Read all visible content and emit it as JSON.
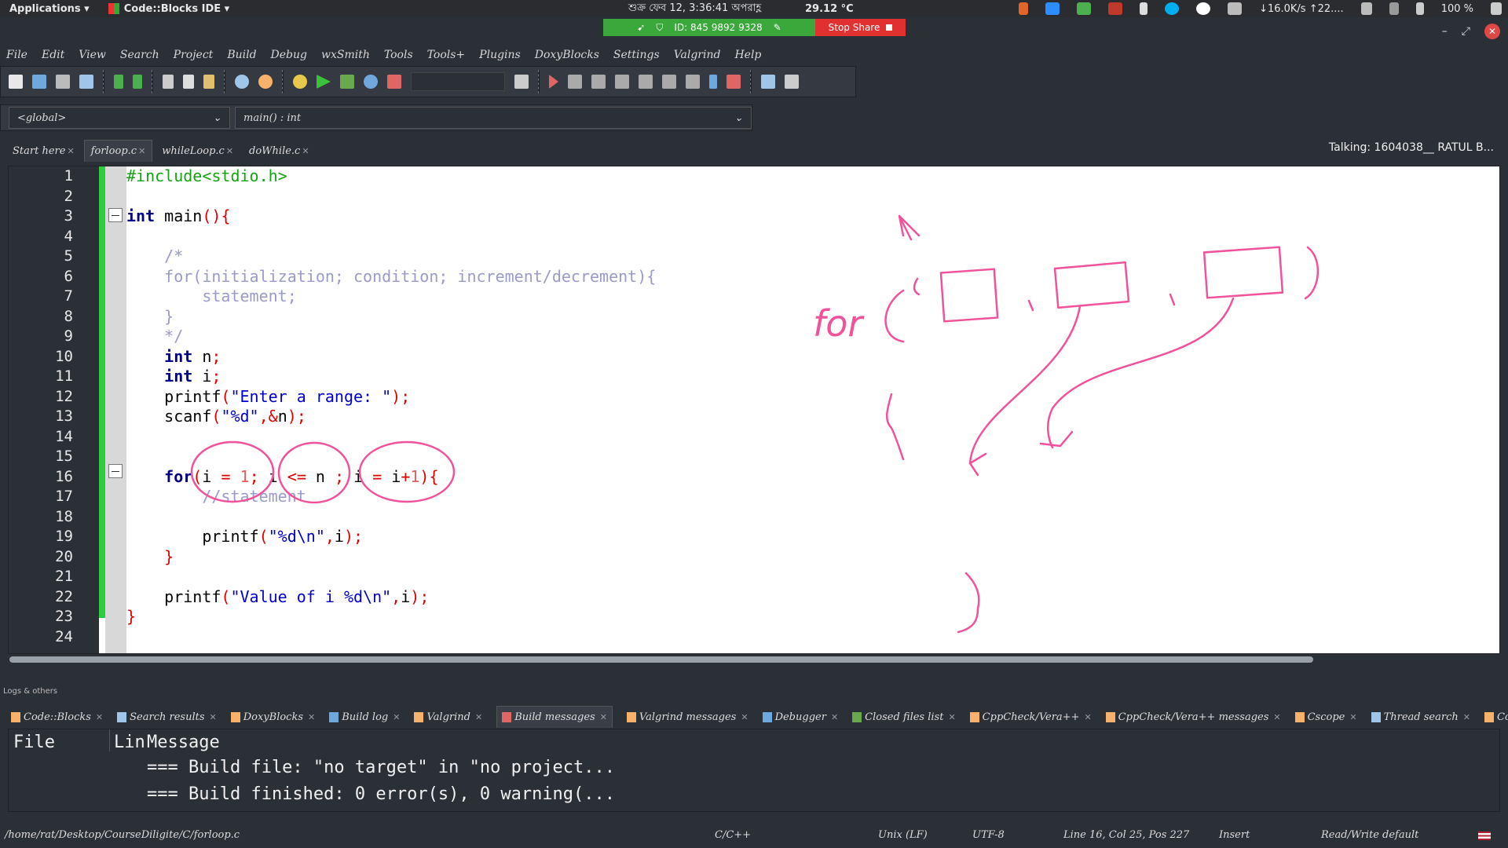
{
  "topbar": {
    "applications": "Applications ▾",
    "app_name": "Code::Blocks IDE ▾",
    "clock": "শুক্র ফেব 12,  3:36:41 অপরাহ্ণ",
    "temperature": "29.12 °C",
    "net_speed": "↓16.0K/s ↑22....",
    "battery": "100 %"
  },
  "share": {
    "meeting_id": "ID: 845 9892 9328",
    "stop_label": "Stop Share"
  },
  "menu": [
    "File",
    "Edit",
    "View",
    "Search",
    "Project",
    "Build",
    "Debug",
    "wxSmith",
    "Tools",
    "Tools+",
    "Plugins",
    "DoxyBlocks",
    "Settings",
    "Valgrind",
    "Help"
  ],
  "scope": {
    "global": "<global>",
    "function": "main() : int"
  },
  "tabs": [
    {
      "label": "Start here"
    },
    {
      "label": "forloop.c"
    },
    {
      "label": "whileLoop.c"
    },
    {
      "label": "doWhile.c"
    }
  ],
  "talking": "Talking: 1604038__ RATUL B...",
  "code_lines": [
    "#include<stdio.h>",
    "",
    "int main(){",
    "",
    "    /*",
    "    for(initialization; condition; increment/decrement){",
    "        statement;",
    "    }",
    "    */",
    "    int n;",
    "    int i;",
    "    printf(\"Enter a range: \");",
    "    scanf(\"%d\",&n);",
    "",
    "",
    "    for(i = 1; i <= n ; i = i+1){",
    "        //statement",
    "",
    "        printf(\"%d\\n\",i);",
    "    }",
    "",
    "    printf(\"Value of i %d\\n\",i);",
    "}",
    ""
  ],
  "line_numbers": [
    "1",
    "2",
    "3",
    "4",
    "5",
    "6",
    "7",
    "8",
    "9",
    "10",
    "11",
    "12",
    "13",
    "14",
    "15",
    "16",
    "17",
    "18",
    "19",
    "20",
    "21",
    "22",
    "23",
    "24"
  ],
  "annotation_text": "for",
  "logs": {
    "header": "Logs & others",
    "tabs": [
      "Code::Blocks",
      "Search results",
      "DoxyBlocks",
      "Build log",
      "Valgrind",
      "Build messages",
      "Valgrind messages",
      "Debugger",
      "Closed files list",
      "CppCheck/Vera++",
      "CppCheck/Vera++ messages",
      "Cscope",
      "Thread search",
      "Cccc"
    ],
    "col_file": "File",
    "col_line": "Lin",
    "col_message": "Message",
    "rows": [
      "=== Build file: \"no target\" in \"no project...",
      "=== Build finished: 0 error(s), 0 warning(..."
    ]
  },
  "status": {
    "path": "/home/rat/Desktop/CourseDiligite/C/forloop.c",
    "language": "C/C++",
    "eol": "Unix (LF)",
    "encoding": "UTF-8",
    "position": "Line 16, Col 25, Pos 227",
    "mode": "Insert",
    "access": "Read/Write",
    "profile": "default"
  }
}
